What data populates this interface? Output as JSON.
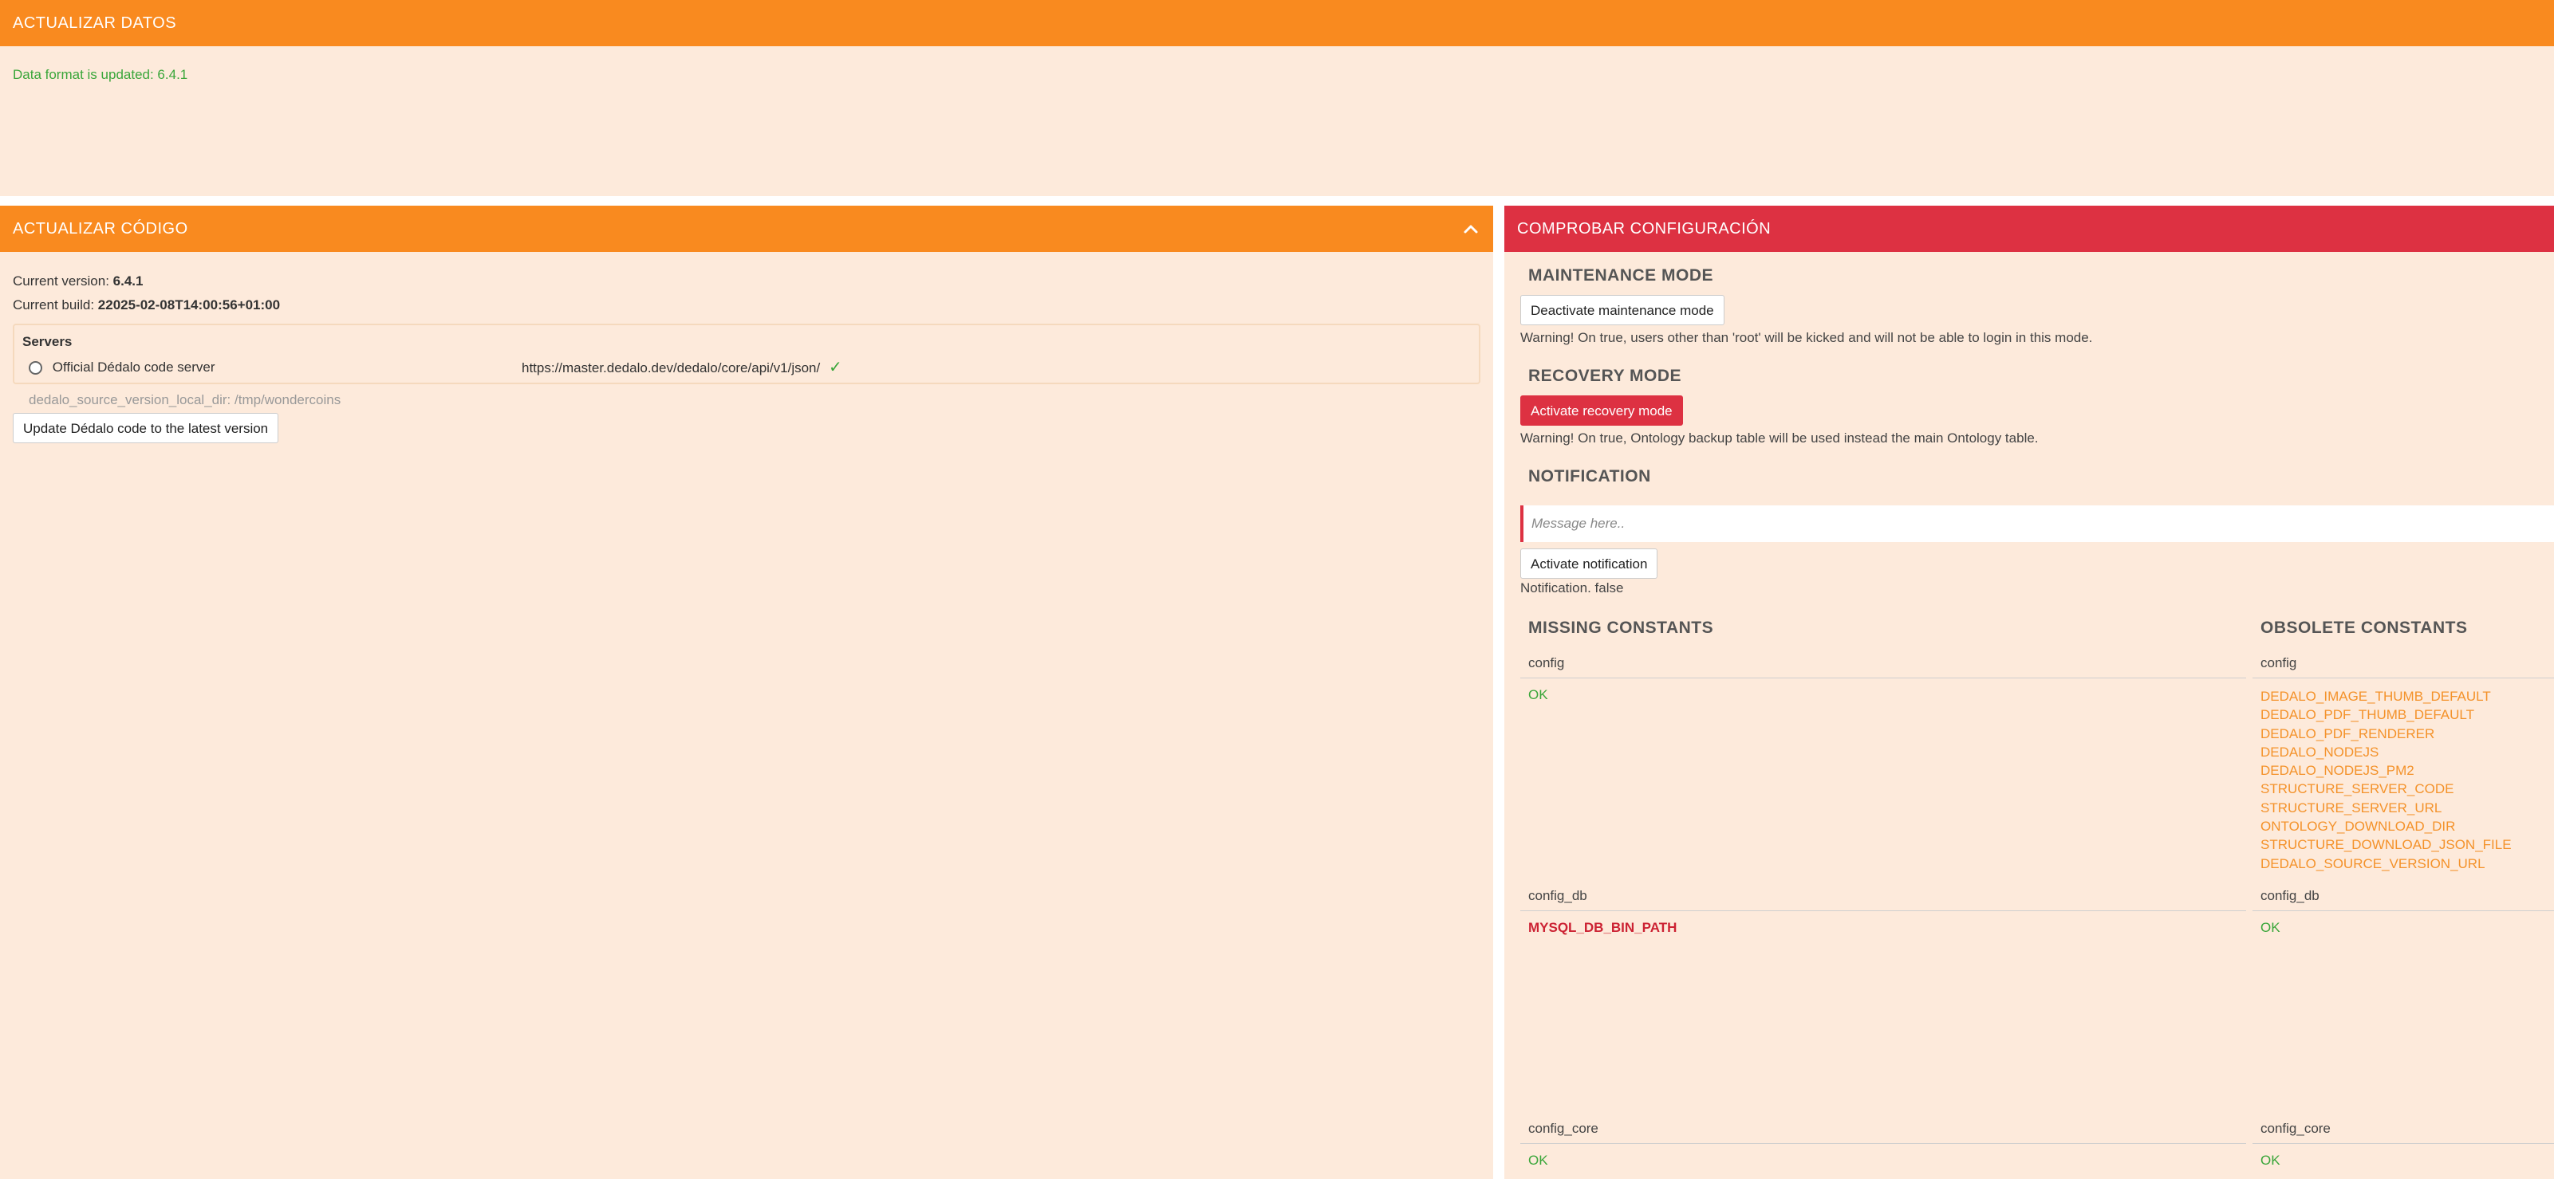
{
  "update_data": {
    "title": "ACTUALIZAR DATOS",
    "message": "Data format is updated: 6.4.1"
  },
  "update_code": {
    "title": "ACTUALIZAR CÓDIGO",
    "current_version_label": "Current version:",
    "current_version": "6.4.1",
    "current_build_label": "Current build:",
    "current_build": "22025-02-08T14:00:56+01:00",
    "servers_title": "Servers",
    "server_name": "Official Dédalo code server",
    "server_url": "https://master.dedalo.dev/dedalo/core/api/v1/json/",
    "local_dir": "dedalo_source_version_local_dir: /tmp/wondercoins",
    "update_button": "Update Dédalo code to the latest version",
    "collapse_icon": "chevron-up-icon"
  },
  "config_check": {
    "title": "COMPROBAR CONFIGURACIÓN",
    "maintenance": {
      "title": "MAINTENANCE MODE",
      "button": "Deactivate maintenance mode",
      "warning": "Warning! On true, users other than 'root' will be kicked and will not be able to login in this mode."
    },
    "recovery": {
      "title": "RECOVERY MODE",
      "button": "Activate recovery mode",
      "warning": "Warning! On true, Ontology backup table will be used instead the main Ontology table."
    },
    "notification": {
      "title": "NOTIFICATION",
      "placeholder": "Message here..",
      "button": "Activate notification",
      "status": "Notification. false"
    },
    "missing_title": "MISSING CONSTANTS",
    "obsolete_title": "OBSOLETE CONSTANTS",
    "groups": {
      "config": {
        "label": "config",
        "missing": "OK",
        "obsolete": [
          "DEDALO_IMAGE_THUMB_DEFAULT",
          "DEDALO_PDF_THUMB_DEFAULT",
          "DEDALO_PDF_RENDERER",
          "DEDALO_NODEJS",
          "DEDALO_NODEJS_PM2",
          "STRUCTURE_SERVER_CODE",
          "STRUCTURE_SERVER_URL",
          "ONTOLOGY_DOWNLOAD_DIR",
          "STRUCTURE_DOWNLOAD_JSON_FILE",
          "DEDALO_SOURCE_VERSION_URL"
        ]
      },
      "config_db": {
        "label": "config_db",
        "missing": "MYSQL_DB_BIN_PATH",
        "obsolete": "OK"
      },
      "config_core": {
        "label": "config_core",
        "missing": "OK",
        "obsolete": "OK"
      }
    }
  },
  "colors": {
    "orange_header": "#f98a1f",
    "red_header": "#dd3142",
    "panel_bg": "#fdeadb",
    "ok_green": "#3aa63a",
    "obsolete_orange": "#f4922a",
    "missing_red": "#cc2233"
  }
}
